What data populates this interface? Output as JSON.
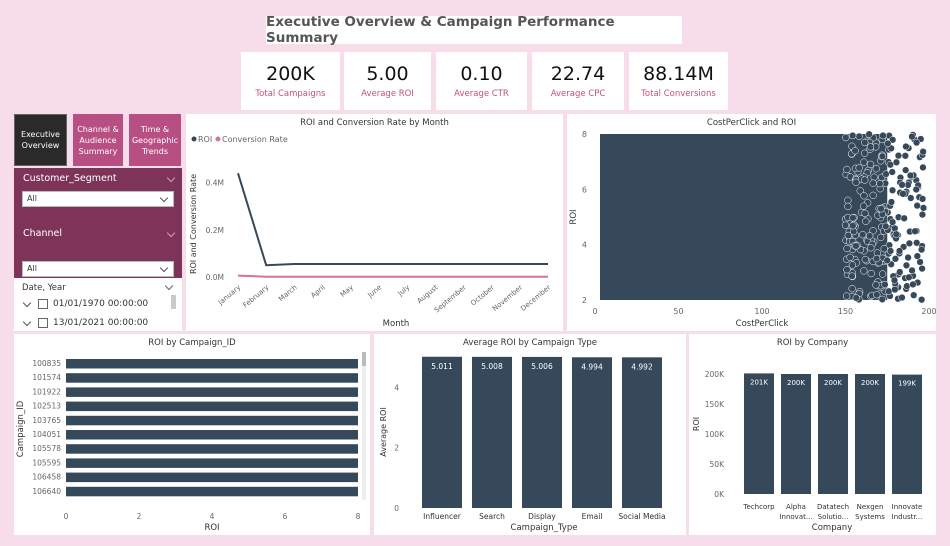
{
  "header": {
    "title": "Executive Overview & Campaign Performance Summary"
  },
  "kpis": [
    {
      "value": "200K",
      "label": "Total Campaigns"
    },
    {
      "value": "5.00",
      "label": "Average ROI"
    },
    {
      "value": "0.10",
      "label": "Average CTR"
    },
    {
      "value": "22.74",
      "label": "Average CPC"
    },
    {
      "value": "88.14M",
      "label": "Total Conversions"
    }
  ],
  "nav": [
    {
      "label": "Executive Overview",
      "active": true
    },
    {
      "label": "Channel & Audience Summary",
      "active": false
    },
    {
      "label": "Time & Geographic Trends",
      "active": false
    }
  ],
  "slicers": {
    "segment": {
      "label": "Customer_Segment",
      "value": "All"
    },
    "channel": {
      "label": "Channel",
      "value": "All"
    },
    "date": {
      "label": "Date, Year",
      "items": [
        "01/01/1970 00:00:00",
        "13/01/2021 00:00:00"
      ]
    }
  },
  "colors": {
    "dark": "#36495a",
    "pink": "#d4739f",
    "accent": "#b84f82"
  },
  "chart_data": [
    {
      "type": "line",
      "title": "ROI and Conversion Rate by Month",
      "xlabel": "Month",
      "ylabel": "ROI and Conversion Rate",
      "legend": "top-left",
      "x": [
        "January",
        "February",
        "March",
        "April",
        "May",
        "June",
        "July",
        "August",
        "September",
        "October",
        "November",
        "December"
      ],
      "yticks": [
        "0.4M",
        "0.2M",
        "0.0M"
      ],
      "ylim": [
        0,
        0.5
      ],
      "series": [
        {
          "name": "ROI",
          "values": [
            0.44,
            0.05,
            0.055,
            0.055,
            0.055,
            0.055,
            0.055,
            0.055,
            0.055,
            0.055,
            0.055,
            0.055
          ]
        },
        {
          "name": "Conversion Rate",
          "values": [
            0.006,
            0.001,
            0.001,
            0.001,
            0.001,
            0.001,
            0.001,
            0.001,
            0.001,
            0.001,
            0.001,
            0.001
          ]
        }
      ]
    },
    {
      "type": "scatter",
      "title": "CostPerClick and ROI",
      "xlabel": "CostPerClick",
      "ylabel": "ROI",
      "xlim": [
        0,
        200
      ],
      "ylim": [
        2,
        8
      ],
      "xticks": [
        0,
        50,
        100,
        150,
        200
      ],
      "yticks": [
        2,
        4,
        6,
        8
      ],
      "description_points": "dense uniform cloud over CostPerClick 0-200, ROI 2-8"
    },
    {
      "type": "bar",
      "title": "ROI by Campaign_ID",
      "xlabel": "ROI",
      "ylabel": "Campaign_ID",
      "categories": [
        "100835",
        "101574",
        "101922",
        "102513",
        "103765",
        "104051",
        "105578",
        "105595",
        "106458",
        "106640"
      ],
      "values": [
        8,
        8,
        8,
        8,
        8,
        8,
        8,
        8,
        8,
        8
      ],
      "xlim": [
        0,
        8
      ],
      "xticks": [
        0,
        2,
        4,
        6,
        8
      ]
    },
    {
      "type": "bar",
      "title": "Average ROI by Campaign Type",
      "xlabel": "Campaign_Type",
      "ylabel": "Average ROI",
      "categories": [
        "Influencer",
        "Search",
        "Display",
        "Email",
        "Social Media"
      ],
      "values": [
        5.011,
        5.008,
        5.006,
        4.994,
        4.992
      ],
      "labels": [
        "5.011",
        "5.008",
        "5.006",
        "4.994",
        "4.992"
      ],
      "ylim": [
        0,
        5.5
      ],
      "yticks": [
        0,
        2,
        4
      ]
    },
    {
      "type": "bar",
      "title": "ROI by Company",
      "xlabel": "Company",
      "ylabel": "ROI",
      "categories": [
        "Techcorp",
        "Alpha Innovat...",
        "Datatech Solutio...",
        "Nexgen Systems",
        "Innovate Industr..."
      ],
      "values": [
        201,
        200,
        200,
        200,
        199
      ],
      "labels": [
        "201K",
        "200K",
        "200K",
        "200K",
        "199K"
      ],
      "yticks": [
        "0K",
        "50K",
        "100K",
        "150K",
        "200K"
      ],
      "ylim": [
        0,
        200
      ]
    }
  ]
}
